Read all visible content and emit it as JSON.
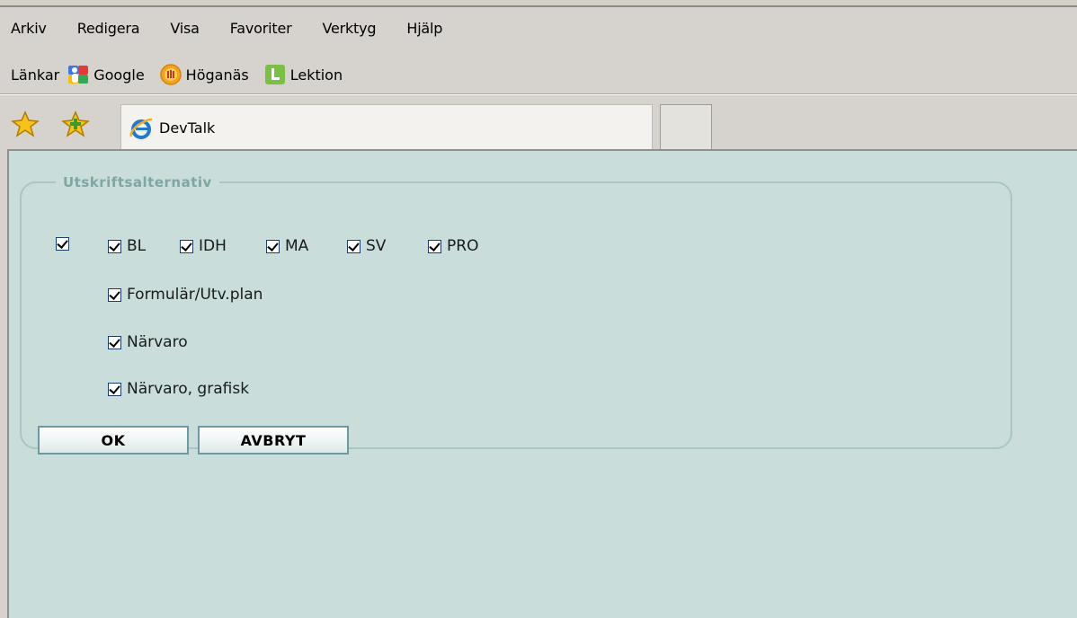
{
  "menubar": {
    "items": [
      "Arkiv",
      "Redigera",
      "Visa",
      "Favoriter",
      "Verktyg",
      "Hjälp"
    ]
  },
  "links_bar": {
    "label": "Länkar",
    "links": [
      {
        "label": "Google",
        "icon": "google-icon"
      },
      {
        "label": "Höganäs",
        "icon": "hoganas-icon"
      },
      {
        "label": "Lektion",
        "icon": "lektion-icon"
      }
    ]
  },
  "tab": {
    "title": "DevTalk",
    "icon": "ie-icon"
  },
  "print_options": {
    "legend": "Utskriftsalternativ",
    "top_row": [
      {
        "label": "",
        "checked": true
      },
      {
        "label": "BL",
        "checked": true
      },
      {
        "label": "IDH",
        "checked": true
      },
      {
        "label": "MA",
        "checked": true
      },
      {
        "label": "SV",
        "checked": true
      },
      {
        "label": "PRO",
        "checked": true
      }
    ],
    "options": [
      {
        "label": "Formulär/Utv.plan",
        "checked": true
      },
      {
        "label": "Närvaro",
        "checked": true
      },
      {
        "label": "Närvaro, grafisk",
        "checked": true
      }
    ],
    "ok_label": "OK",
    "cancel_label": "AVBRYT"
  },
  "colors": {
    "content_background": "#c9dedb",
    "panel_border": "#a9c6c3",
    "legend_text": "#7ea6a3",
    "button_border": "#6d99a2"
  }
}
